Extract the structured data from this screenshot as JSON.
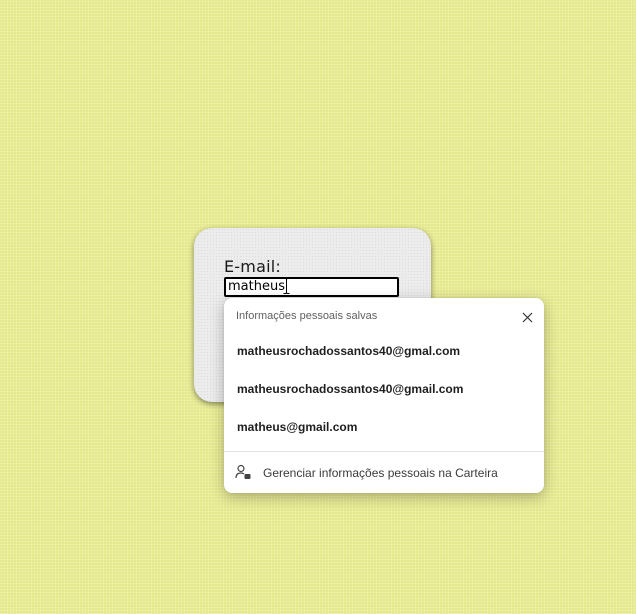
{
  "form": {
    "email_label": "E-mail:",
    "email_value": "matheus"
  },
  "autofill": {
    "header": "Informações pessoais salvas",
    "close_icon": "close-icon",
    "suggestions": [
      "matheusrochadossantos40@gmal.com",
      "matheusrochadossantos40@gmail.com",
      "matheus@gmail.com"
    ],
    "manage_icon": "person-wallet-icon",
    "manage_label": "Gerenciar informações pessoais na Carteira"
  },
  "colors": {
    "page_background": "#e8ec93",
    "card_background": "#ececec",
    "popup_background": "#ffffff"
  }
}
